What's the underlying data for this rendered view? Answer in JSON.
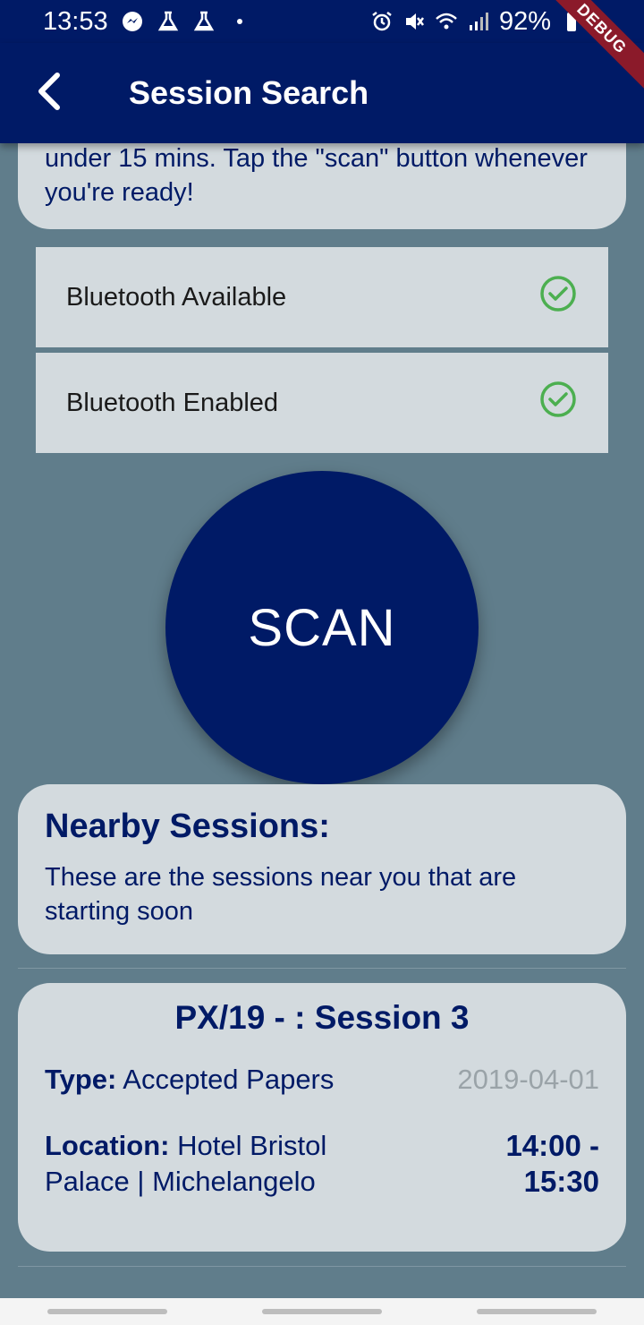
{
  "status_bar": {
    "time": "13:53",
    "battery": "92%",
    "icons_left": [
      "messenger-icon",
      "flask-icon",
      "flask-icon",
      "dot-icon"
    ],
    "icons_right": [
      "alarm-icon",
      "mute-icon",
      "wifi-icon",
      "signal-icon",
      "battery-icon"
    ]
  },
  "debug_banner": "DEBUG",
  "app_bar": {
    "title": "Session Search"
  },
  "intro": {
    "text": "under 15 mins. Tap the \"scan\" button whenever you're ready!"
  },
  "checks": [
    {
      "label": "Bluetooth Available",
      "status": "ok"
    },
    {
      "label": "Bluetooth Enabled",
      "status": "ok"
    }
  ],
  "scan_button": {
    "label": "SCAN"
  },
  "nearby": {
    "title": "Nearby Sessions:",
    "description": "These are the sessions near you that are starting soon"
  },
  "session": {
    "title": "PX/19 - : Session 3",
    "type_label": "Type:",
    "type_value": "Accepted Papers",
    "date": "2019-04-01",
    "location_label": "Location:",
    "location_value": "Hotel Bristol Palace | Michelangelo",
    "time_start": "14:00 -",
    "time_end": "15:30"
  },
  "colors": {
    "primary": "#001a66",
    "background": "#607d8b",
    "card": "#d3dade",
    "check_green": "#4caf50",
    "debug_red": "#8b1a2a"
  }
}
